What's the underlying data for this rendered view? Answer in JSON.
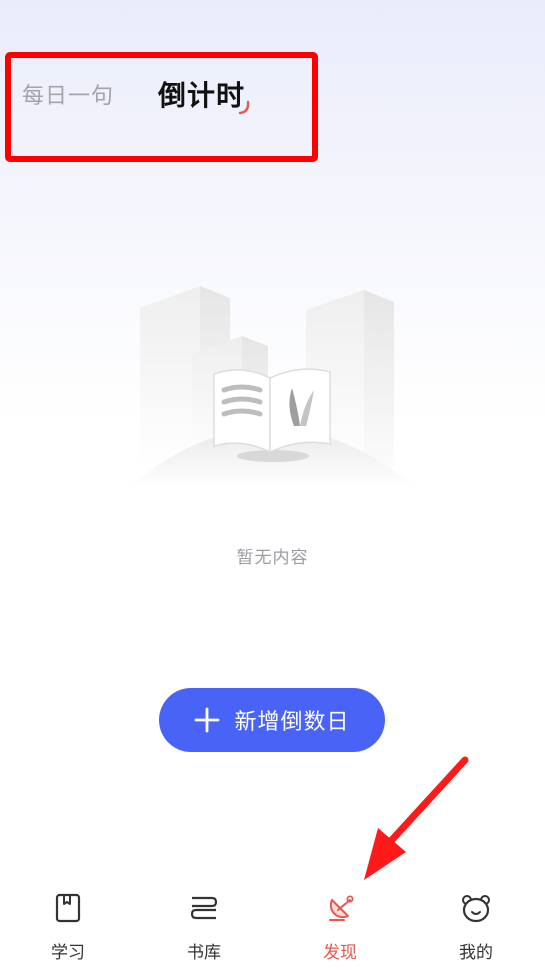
{
  "header": {
    "tabs": [
      {
        "label": "每日一句",
        "active": false
      },
      {
        "label": "倒计时",
        "active": true
      }
    ]
  },
  "empty_state": {
    "message": "暂无内容",
    "illustration": "empty-box-icon"
  },
  "add_button": {
    "label": "新增倒数日",
    "icon": "plus-icon",
    "color": "#4a63f7"
  },
  "bottom_nav": {
    "items": [
      {
        "label": "学习",
        "icon": "book-icon",
        "active": false
      },
      {
        "label": "书库",
        "icon": "library-icon",
        "active": false
      },
      {
        "label": "发现",
        "icon": "discover-icon",
        "active": true
      },
      {
        "label": "我的",
        "icon": "bear-face-icon",
        "active": false
      }
    ],
    "active_color": "#e8574d"
  }
}
